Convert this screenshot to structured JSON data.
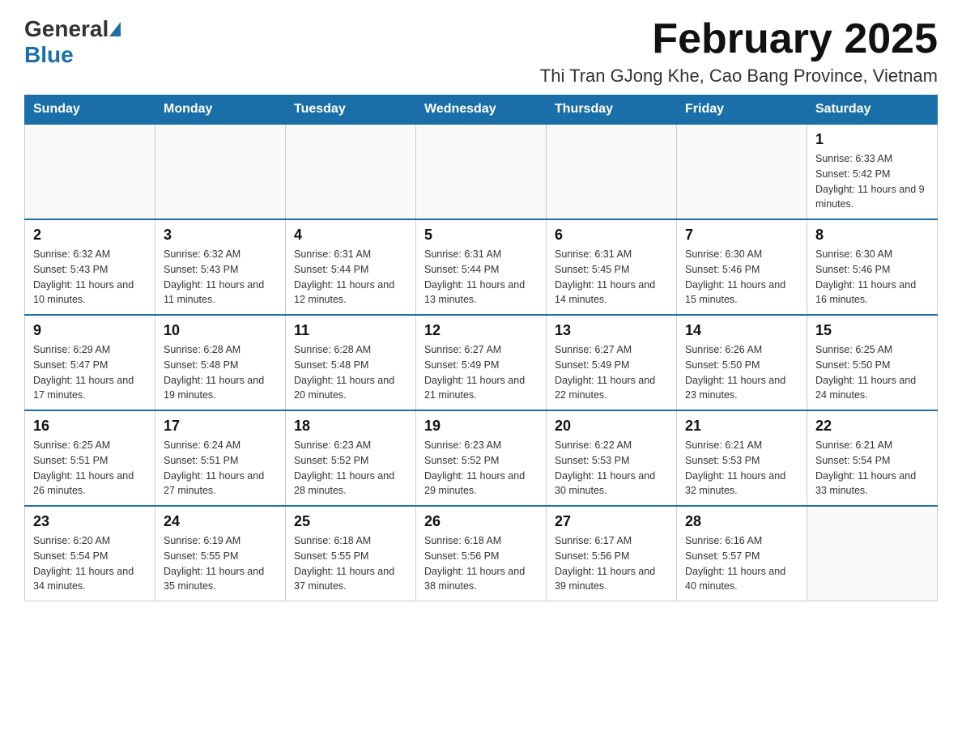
{
  "header": {
    "logo_general": "General",
    "logo_blue": "Blue",
    "title": "February 2025",
    "subtitle": "Thi Tran GJong Khe, Cao Bang Province, Vietnam"
  },
  "weekdays": [
    "Sunday",
    "Monday",
    "Tuesday",
    "Wednesday",
    "Thursday",
    "Friday",
    "Saturday"
  ],
  "weeks": [
    [
      {
        "day": "",
        "info": ""
      },
      {
        "day": "",
        "info": ""
      },
      {
        "day": "",
        "info": ""
      },
      {
        "day": "",
        "info": ""
      },
      {
        "day": "",
        "info": ""
      },
      {
        "day": "",
        "info": ""
      },
      {
        "day": "1",
        "info": "Sunrise: 6:33 AM\nSunset: 5:42 PM\nDaylight: 11 hours and 9 minutes."
      }
    ],
    [
      {
        "day": "2",
        "info": "Sunrise: 6:32 AM\nSunset: 5:43 PM\nDaylight: 11 hours and 10 minutes."
      },
      {
        "day": "3",
        "info": "Sunrise: 6:32 AM\nSunset: 5:43 PM\nDaylight: 11 hours and 11 minutes."
      },
      {
        "day": "4",
        "info": "Sunrise: 6:31 AM\nSunset: 5:44 PM\nDaylight: 11 hours and 12 minutes."
      },
      {
        "day": "5",
        "info": "Sunrise: 6:31 AM\nSunset: 5:44 PM\nDaylight: 11 hours and 13 minutes."
      },
      {
        "day": "6",
        "info": "Sunrise: 6:31 AM\nSunset: 5:45 PM\nDaylight: 11 hours and 14 minutes."
      },
      {
        "day": "7",
        "info": "Sunrise: 6:30 AM\nSunset: 5:46 PM\nDaylight: 11 hours and 15 minutes."
      },
      {
        "day": "8",
        "info": "Sunrise: 6:30 AM\nSunset: 5:46 PM\nDaylight: 11 hours and 16 minutes."
      }
    ],
    [
      {
        "day": "9",
        "info": "Sunrise: 6:29 AM\nSunset: 5:47 PM\nDaylight: 11 hours and 17 minutes."
      },
      {
        "day": "10",
        "info": "Sunrise: 6:28 AM\nSunset: 5:48 PM\nDaylight: 11 hours and 19 minutes."
      },
      {
        "day": "11",
        "info": "Sunrise: 6:28 AM\nSunset: 5:48 PM\nDaylight: 11 hours and 20 minutes."
      },
      {
        "day": "12",
        "info": "Sunrise: 6:27 AM\nSunset: 5:49 PM\nDaylight: 11 hours and 21 minutes."
      },
      {
        "day": "13",
        "info": "Sunrise: 6:27 AM\nSunset: 5:49 PM\nDaylight: 11 hours and 22 minutes."
      },
      {
        "day": "14",
        "info": "Sunrise: 6:26 AM\nSunset: 5:50 PM\nDaylight: 11 hours and 23 minutes."
      },
      {
        "day": "15",
        "info": "Sunrise: 6:25 AM\nSunset: 5:50 PM\nDaylight: 11 hours and 24 minutes."
      }
    ],
    [
      {
        "day": "16",
        "info": "Sunrise: 6:25 AM\nSunset: 5:51 PM\nDaylight: 11 hours and 26 minutes."
      },
      {
        "day": "17",
        "info": "Sunrise: 6:24 AM\nSunset: 5:51 PM\nDaylight: 11 hours and 27 minutes."
      },
      {
        "day": "18",
        "info": "Sunrise: 6:23 AM\nSunset: 5:52 PM\nDaylight: 11 hours and 28 minutes."
      },
      {
        "day": "19",
        "info": "Sunrise: 6:23 AM\nSunset: 5:52 PM\nDaylight: 11 hours and 29 minutes."
      },
      {
        "day": "20",
        "info": "Sunrise: 6:22 AM\nSunset: 5:53 PM\nDaylight: 11 hours and 30 minutes."
      },
      {
        "day": "21",
        "info": "Sunrise: 6:21 AM\nSunset: 5:53 PM\nDaylight: 11 hours and 32 minutes."
      },
      {
        "day": "22",
        "info": "Sunrise: 6:21 AM\nSunset: 5:54 PM\nDaylight: 11 hours and 33 minutes."
      }
    ],
    [
      {
        "day": "23",
        "info": "Sunrise: 6:20 AM\nSunset: 5:54 PM\nDaylight: 11 hours and 34 minutes."
      },
      {
        "day": "24",
        "info": "Sunrise: 6:19 AM\nSunset: 5:55 PM\nDaylight: 11 hours and 35 minutes."
      },
      {
        "day": "25",
        "info": "Sunrise: 6:18 AM\nSunset: 5:55 PM\nDaylight: 11 hours and 37 minutes."
      },
      {
        "day": "26",
        "info": "Sunrise: 6:18 AM\nSunset: 5:56 PM\nDaylight: 11 hours and 38 minutes."
      },
      {
        "day": "27",
        "info": "Sunrise: 6:17 AM\nSunset: 5:56 PM\nDaylight: 11 hours and 39 minutes."
      },
      {
        "day": "28",
        "info": "Sunrise: 6:16 AM\nSunset: 5:57 PM\nDaylight: 11 hours and 40 minutes."
      },
      {
        "day": "",
        "info": ""
      }
    ]
  ]
}
